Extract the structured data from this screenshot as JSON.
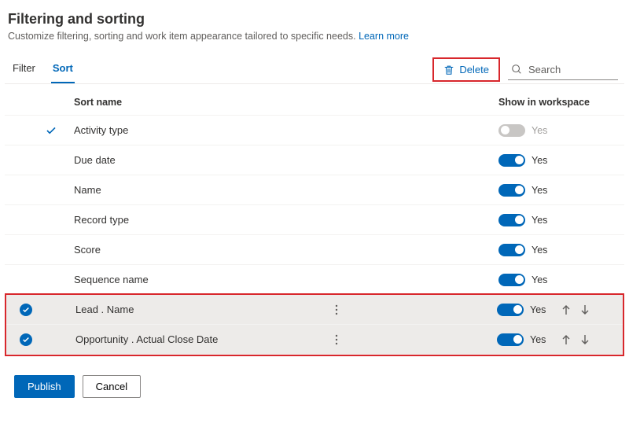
{
  "header": {
    "title": "Filtering and sorting",
    "subtitle": "Customize filtering, sorting and work item appearance tailored to specific needs.",
    "learn_more": "Learn more"
  },
  "tabs": {
    "filter": "Filter",
    "sort": "Sort"
  },
  "toolbar": {
    "delete_label": "Delete",
    "search_placeholder": "Search"
  },
  "columns": {
    "name": "Sort name",
    "show": "Show in workspace"
  },
  "rows": [
    {
      "name": "Activity type",
      "toggle_on": false,
      "toggle_label": "Yes",
      "default": true,
      "selected": false,
      "reorder": false
    },
    {
      "name": "Due date",
      "toggle_on": true,
      "toggle_label": "Yes",
      "default": false,
      "selected": false,
      "reorder": false
    },
    {
      "name": "Name",
      "toggle_on": true,
      "toggle_label": "Yes",
      "default": false,
      "selected": false,
      "reorder": false
    },
    {
      "name": "Record type",
      "toggle_on": true,
      "toggle_label": "Yes",
      "default": false,
      "selected": false,
      "reorder": false
    },
    {
      "name": "Score",
      "toggle_on": true,
      "toggle_label": "Yes",
      "default": false,
      "selected": false,
      "reorder": false
    },
    {
      "name": "Sequence name",
      "toggle_on": true,
      "toggle_label": "Yes",
      "default": false,
      "selected": false,
      "reorder": false
    },
    {
      "name": "Lead . Name",
      "toggle_on": true,
      "toggle_label": "Yes",
      "default": false,
      "selected": true,
      "reorder": true
    },
    {
      "name": "Opportunity . Actual Close Date",
      "toggle_on": true,
      "toggle_label": "Yes",
      "default": false,
      "selected": true,
      "reorder": true
    }
  ],
  "footer": {
    "publish": "Publish",
    "cancel": "Cancel"
  }
}
